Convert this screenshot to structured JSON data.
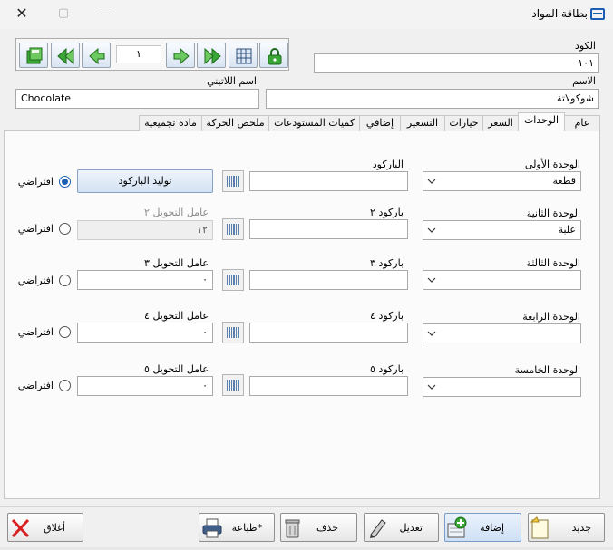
{
  "window": {
    "title": "بطاقة المواد",
    "close_glyph": "✕",
    "maximize_glyph": "▢",
    "minimize_glyph": "—"
  },
  "toolbar": {
    "record_number": "١"
  },
  "header": {
    "code_label": "الكود",
    "code_value": "١٠١",
    "name_label": "الاسم",
    "name_value": "شوكولاتة",
    "latin_name_label": "اسم اللاتيني",
    "latin_name_value": "Chocolate"
  },
  "tabs": [
    {
      "label": "عام"
    },
    {
      "label": "الوحدات"
    },
    {
      "label": "السعر"
    },
    {
      "label": "خيارات"
    },
    {
      "label": "التسعير"
    },
    {
      "label": "إضافي"
    },
    {
      "label": "كميات المستودعات"
    },
    {
      "label": "ملخص الحركة"
    },
    {
      "label": "مادة تجميعية"
    }
  ],
  "active_tab": "الوحدات",
  "units": {
    "rows": [
      {
        "unit_label": "الوحدة الأولى",
        "unit_value": "قطعة",
        "barcode_label": "الباركود",
        "barcode_value": "",
        "generate_button": "توليد الباركود",
        "default_label": "افتراضي",
        "default_selected": true
      },
      {
        "unit_label": "الوحدة الثانية",
        "unit_value": "علبة",
        "barcode_label": "باركود ٢",
        "barcode_value": "",
        "factor_label": "عامل التحويل ٢",
        "factor_value": "١٢",
        "default_label": "افتراضي",
        "default_selected": false
      },
      {
        "unit_label": "الوحدة الثالثة",
        "unit_value": "",
        "barcode_label": "باركود ٣",
        "barcode_value": "",
        "factor_label": "عامل التحويل ٣",
        "factor_value": "٠",
        "default_label": "افتراضي",
        "default_selected": false
      },
      {
        "unit_label": "الوحدة الرابعة",
        "unit_value": "",
        "barcode_label": "باركود ٤",
        "barcode_value": "",
        "factor_label": "عامل التحويل ٤",
        "factor_value": "٠",
        "default_label": "افتراضي",
        "default_selected": false
      },
      {
        "unit_label": "الوحدة الخامسة",
        "unit_value": "",
        "barcode_label": "باركود ٥",
        "barcode_value": "",
        "factor_label": "عامل التحويل ٥",
        "factor_value": "٠",
        "default_label": "افتراضي",
        "default_selected": false
      }
    ]
  },
  "bottom": {
    "new_label": "جديد",
    "add_label": "إضافة",
    "edit_label": "تعديل",
    "delete_label": "حذف",
    "print_label": "طباعة*",
    "close_label": "أغلاق"
  },
  "colors": {
    "accent": "#1a5fb4",
    "nav_green": "#3aa635",
    "close_red": "#d92020"
  }
}
